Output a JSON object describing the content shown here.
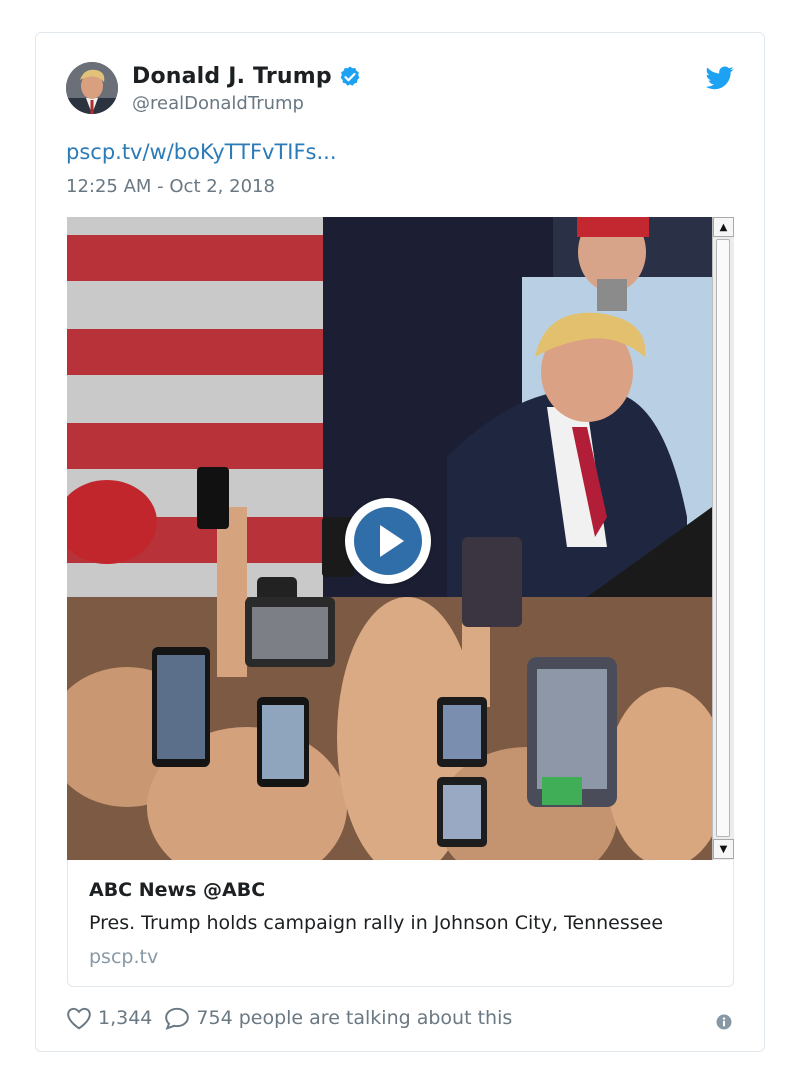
{
  "tweet": {
    "display_name": "Donald J. Trump",
    "handle": "@realDonaldTrump",
    "link_text": "pscp.tv/w/boKyTTFvTIFs...",
    "timestamp": "12:25 AM - Oct 2, 2018",
    "verified": true
  },
  "media": {
    "has_play_button": true,
    "scrollbar_up": "▲",
    "scrollbar_down": "▼"
  },
  "card": {
    "title": "ABC News @ABC",
    "description": "Pres. Trump holds campaign rally in Johnson City, Tennessee",
    "domain": "pscp.tv"
  },
  "actions": {
    "likes": "1,344",
    "talking": "754 people are talking about this"
  },
  "icons": {
    "verified": "verified-badge-icon",
    "brand": "twitter-bird-icon",
    "like": "heart-icon",
    "reply": "speech-bubble-icon",
    "info": "info-icon",
    "play": "play-icon"
  },
  "colors": {
    "brand_blue": "#1da1f2",
    "link_blue": "#2b7bb9",
    "play_blue": "#2f6ea8",
    "secondary_text": "#697882",
    "border": "#e1e8ed"
  }
}
